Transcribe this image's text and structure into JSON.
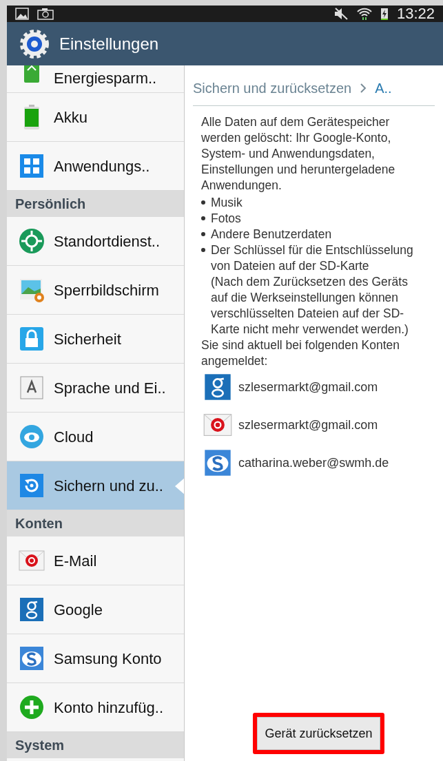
{
  "status_bar": {
    "time": "13:22"
  },
  "app_bar": {
    "title": "Einstellungen"
  },
  "sidebar": {
    "items": [
      {
        "kind": "item",
        "label": "Energiesparm..",
        "selected": false
      },
      {
        "kind": "item",
        "label": "Akku",
        "selected": false
      },
      {
        "kind": "item",
        "label": "Anwendungs..",
        "selected": false
      },
      {
        "kind": "header",
        "label": "Persönlich"
      },
      {
        "kind": "item",
        "label": "Standortdienst..",
        "selected": false
      },
      {
        "kind": "item",
        "label": "Sperrbildschirm",
        "selected": false
      },
      {
        "kind": "item",
        "label": "Sicherheit",
        "selected": false
      },
      {
        "kind": "item",
        "label": "Sprache und Ei..",
        "selected": false
      },
      {
        "kind": "item",
        "label": "Cloud",
        "selected": false
      },
      {
        "kind": "item",
        "label": "Sichern und zu..",
        "selected": true
      },
      {
        "kind": "header",
        "label": "Konten"
      },
      {
        "kind": "item",
        "label": "E-Mail",
        "selected": false
      },
      {
        "kind": "item",
        "label": "Google",
        "selected": false
      },
      {
        "kind": "item",
        "label": "Samsung Konto",
        "selected": false
      },
      {
        "kind": "item",
        "label": "Konto hinzufüg..",
        "selected": false
      },
      {
        "kind": "header",
        "label": "System"
      }
    ]
  },
  "detail": {
    "breadcrumb": [
      "Sichern und zurücksetzen",
      "A.."
    ],
    "intro": "Alle Daten auf dem Gerätespeicher werden gelöscht: Ihr Google-Konto, System- und Anwendungsdaten, Einstellungen und heruntergeladene Anwendungen.",
    "bullets": [
      "Musik",
      "Fotos",
      "Andere Benutzerdaten",
      "Der Schlüssel für die Entschlüsselung von Dateien auf der SD-Karte\n(Nach dem Zurücksetzen des Geräts auf die Werkseinstellungen können verschlüsselten Dateien auf der SD-Karte nicht mehr verwendet werden.)"
    ],
    "accounts_intro": "Sie sind aktuell bei folgenden Konten angemeldet:",
    "accounts": [
      {
        "kind": "google",
        "email": "szlesermarkt@gmail.com"
      },
      {
        "kind": "email",
        "email": "szlesermarkt@gmail.com"
      },
      {
        "kind": "samsung",
        "email": "catharina.weber@swmh.de"
      }
    ],
    "reset_button": {
      "label": "Gerät zurücksetzen",
      "highlighted": true
    }
  }
}
